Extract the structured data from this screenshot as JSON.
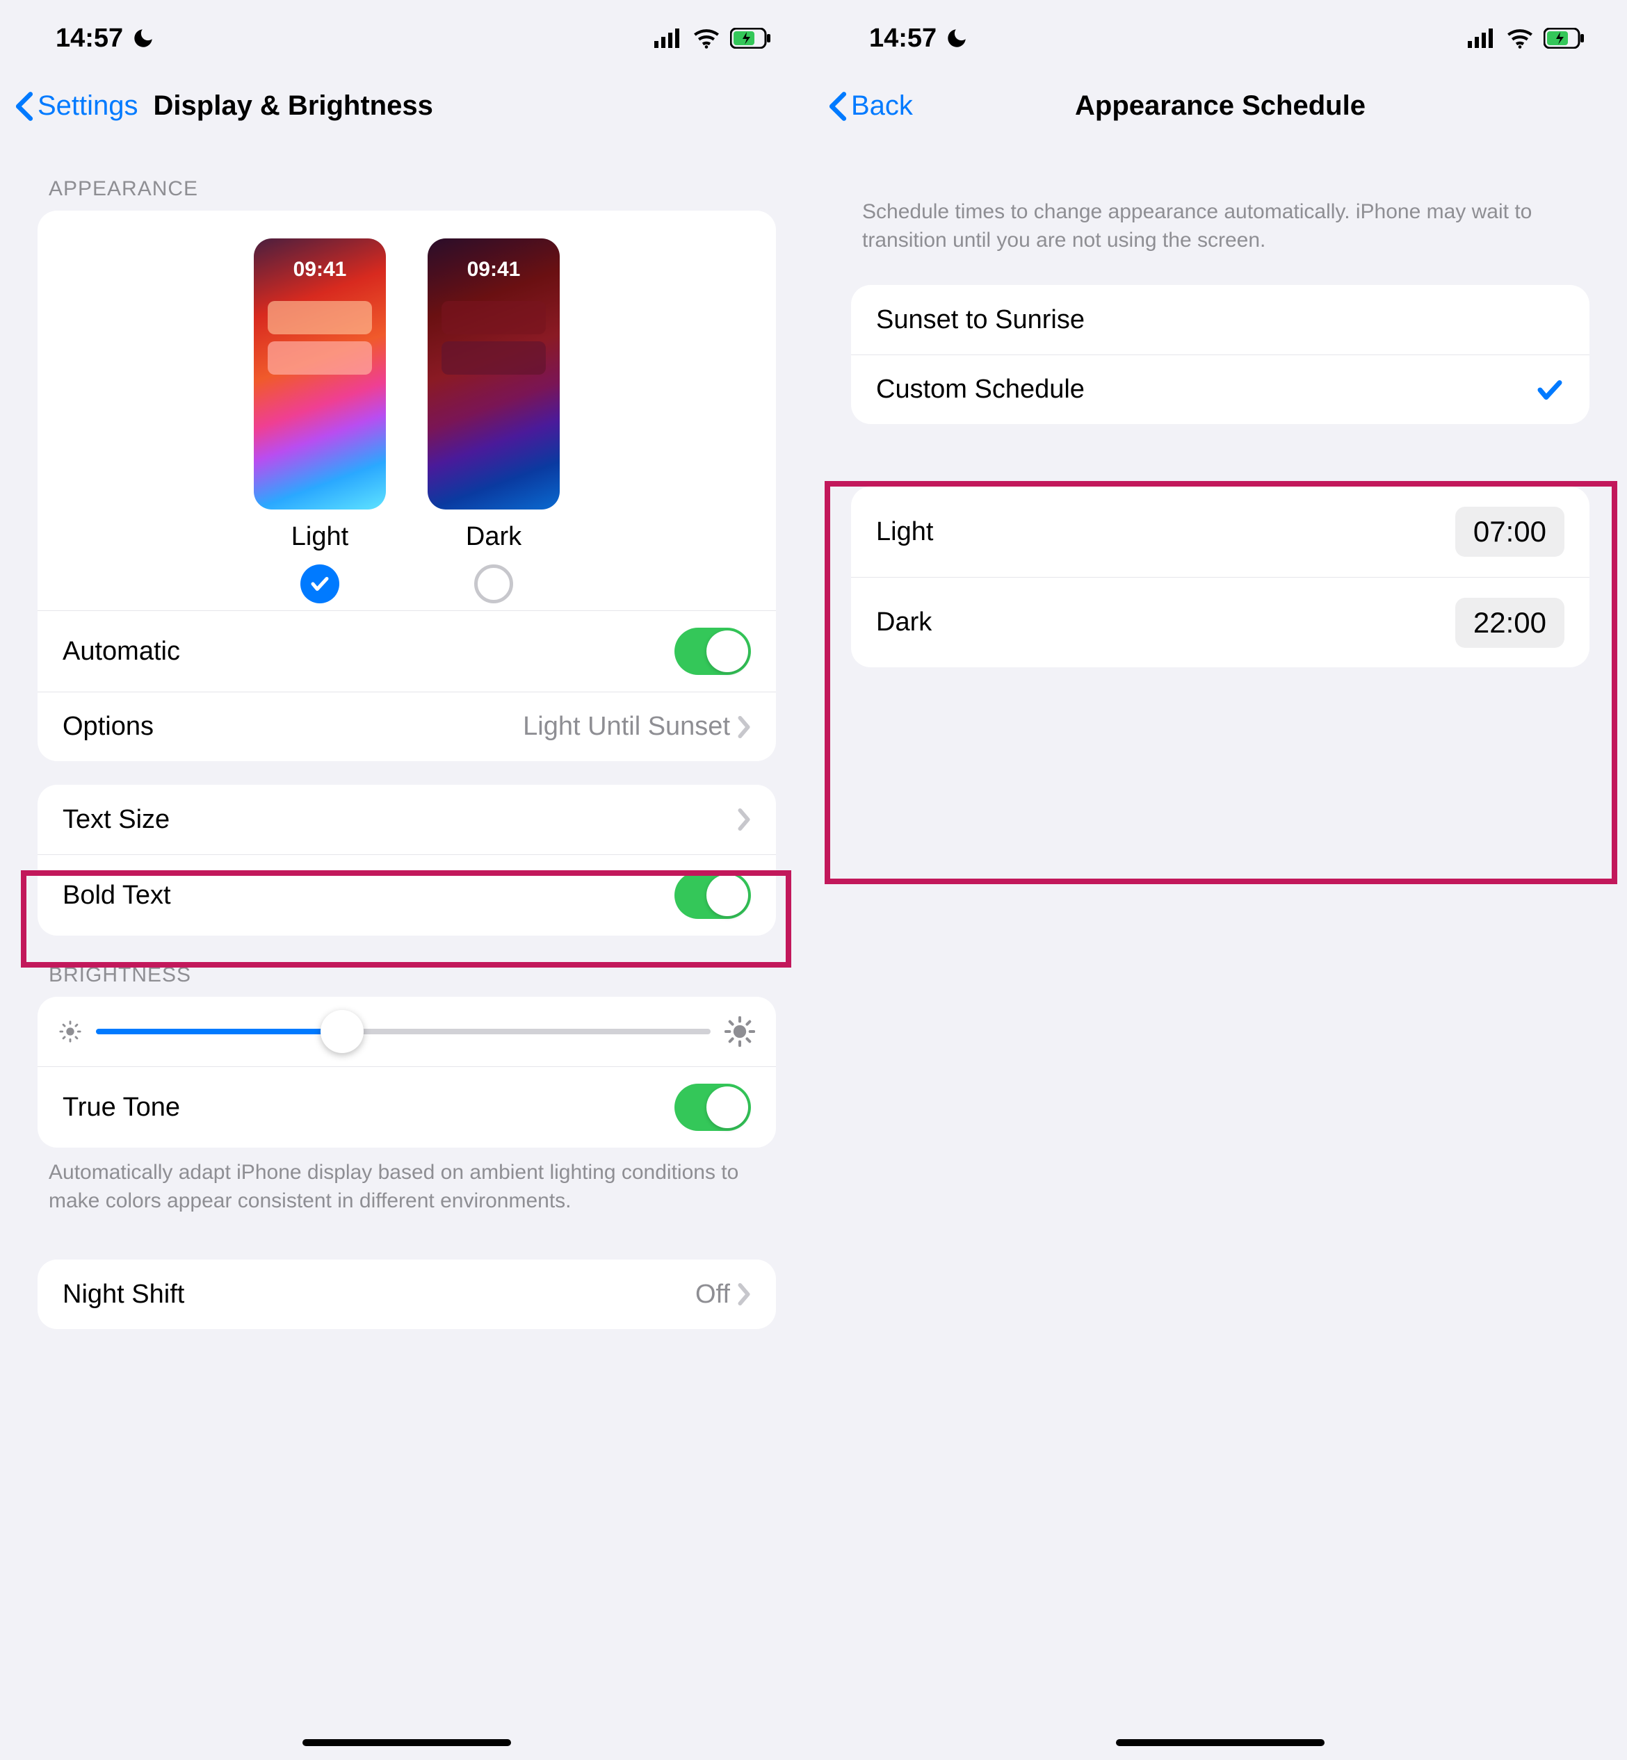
{
  "status": {
    "time": "14:57"
  },
  "left": {
    "nav": {
      "back": "Settings",
      "title": "Display & Brightness"
    },
    "appearance": {
      "header": "APPEARANCE",
      "preview_time": "09:41",
      "light_label": "Light",
      "dark_label": "Dark",
      "automatic_label": "Automatic",
      "options_label": "Options",
      "options_value": "Light Until Sunset"
    },
    "text": {
      "text_size": "Text Size",
      "bold_text": "Bold Text"
    },
    "brightness": {
      "header": "BRIGHTNESS",
      "true_tone": "True Tone",
      "footer": "Automatically adapt iPhone display based on ambient lighting conditions to make colors appear consistent in different environments."
    },
    "night_shift": {
      "label": "Night Shift",
      "value": "Off"
    }
  },
  "right": {
    "nav": {
      "back": "Back",
      "title": "Appearance Schedule"
    },
    "intro": "Schedule times to change appearance automatically. iPhone may wait to transition until you are not using the screen.",
    "schedule": {
      "sunset": "Sunset to Sunrise",
      "custom": "Custom Schedule",
      "light_label": "Light",
      "light_time": "07:00",
      "dark_label": "Dark",
      "dark_time": "22:00"
    }
  }
}
